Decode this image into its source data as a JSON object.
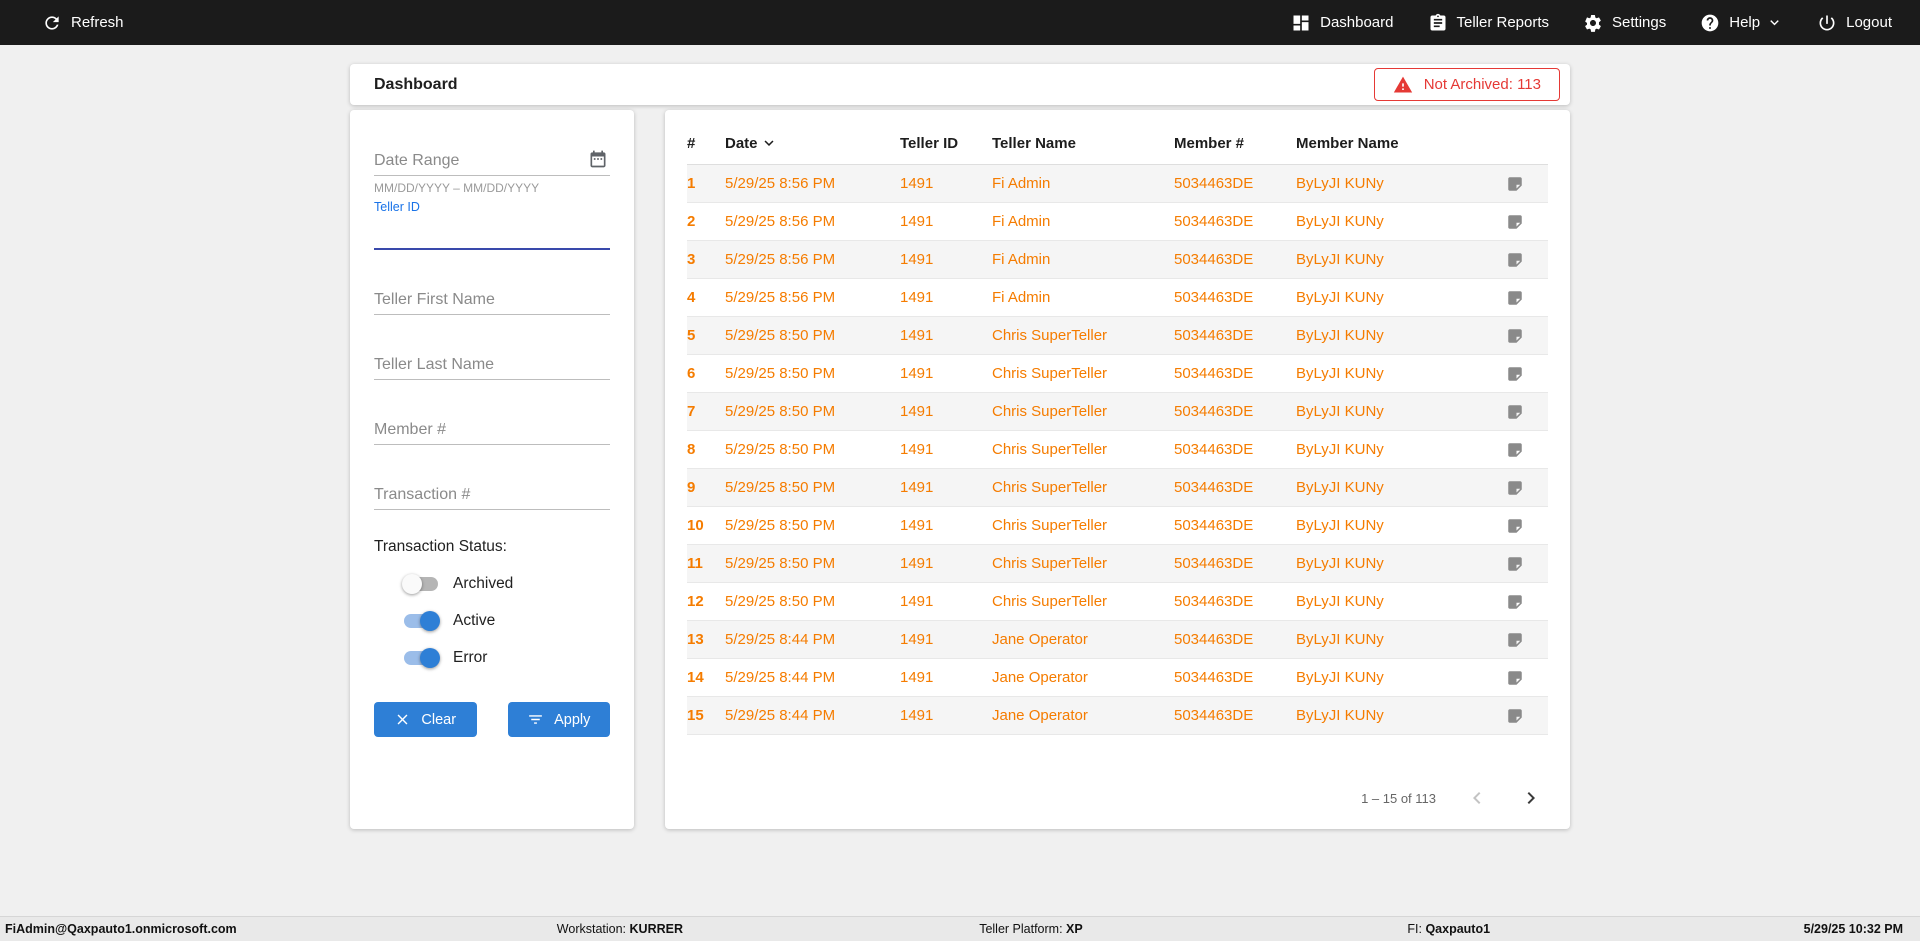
{
  "topbar": {
    "refresh": {
      "label": "Refresh"
    },
    "nav": [
      {
        "label": "Dashboard"
      },
      {
        "label": "Teller Reports"
      },
      {
        "label": "Settings"
      },
      {
        "label": "Help"
      },
      {
        "label": "Logout"
      }
    ]
  },
  "header": {
    "title": "Dashboard",
    "not_archived_badge": "Not Archived: 113"
  },
  "filters": {
    "date_range": {
      "placeholder": "Date Range",
      "value": "",
      "helper": "MM/DD/YYYY – MM/DD/YYYY"
    },
    "teller_id": {
      "label": "Teller ID",
      "value": ""
    },
    "teller_first_name": {
      "placeholder": "Teller First Name",
      "value": ""
    },
    "teller_last_name": {
      "placeholder": "Teller Last Name",
      "value": ""
    },
    "member_number": {
      "placeholder": "Member #",
      "value": ""
    },
    "transaction_number": {
      "placeholder": "Transaction #",
      "value": ""
    },
    "status_label": "Transaction Status:",
    "toggles": [
      {
        "label": "Archived",
        "on": false
      },
      {
        "label": "Active",
        "on": true
      },
      {
        "label": "Error",
        "on": true
      }
    ],
    "clear_button": "Clear",
    "apply_button": "Apply"
  },
  "table": {
    "columns": [
      "#",
      "Date",
      "Teller ID",
      "Teller Name",
      "Member #",
      "Member Name"
    ],
    "sorted_column": "Date",
    "sort_direction": "desc",
    "rows": [
      {
        "num": "1",
        "date": "5/29/25 8:56 PM",
        "teller_id": "1491",
        "teller_name": "Fi Admin",
        "member_num": "5034463DE",
        "member_name": "ByLyJI KUNy"
      },
      {
        "num": "2",
        "date": "5/29/25 8:56 PM",
        "teller_id": "1491",
        "teller_name": "Fi Admin",
        "member_num": "5034463DE",
        "member_name": "ByLyJI KUNy"
      },
      {
        "num": "3",
        "date": "5/29/25 8:56 PM",
        "teller_id": "1491",
        "teller_name": "Fi Admin",
        "member_num": "5034463DE",
        "member_name": "ByLyJI KUNy"
      },
      {
        "num": "4",
        "date": "5/29/25 8:56 PM",
        "teller_id": "1491",
        "teller_name": "Fi Admin",
        "member_num": "5034463DE",
        "member_name": "ByLyJI KUNy"
      },
      {
        "num": "5",
        "date": "5/29/25 8:50 PM",
        "teller_id": "1491",
        "teller_name": "Chris SuperTeller",
        "member_num": "5034463DE",
        "member_name": "ByLyJI KUNy"
      },
      {
        "num": "6",
        "date": "5/29/25 8:50 PM",
        "teller_id": "1491",
        "teller_name": "Chris SuperTeller",
        "member_num": "5034463DE",
        "member_name": "ByLyJI KUNy"
      },
      {
        "num": "7",
        "date": "5/29/25 8:50 PM",
        "teller_id": "1491",
        "teller_name": "Chris SuperTeller",
        "member_num": "5034463DE",
        "member_name": "ByLyJI KUNy"
      },
      {
        "num": "8",
        "date": "5/29/25 8:50 PM",
        "teller_id": "1491",
        "teller_name": "Chris SuperTeller",
        "member_num": "5034463DE",
        "member_name": "ByLyJI KUNy"
      },
      {
        "num": "9",
        "date": "5/29/25 8:50 PM",
        "teller_id": "1491",
        "teller_name": "Chris SuperTeller",
        "member_num": "5034463DE",
        "member_name": "ByLyJI KUNy"
      },
      {
        "num": "10",
        "date": "5/29/25 8:50 PM",
        "teller_id": "1491",
        "teller_name": "Chris SuperTeller",
        "member_num": "5034463DE",
        "member_name": "ByLyJI KUNy"
      },
      {
        "num": "11",
        "date": "5/29/25 8:50 PM",
        "teller_id": "1491",
        "teller_name": "Chris SuperTeller",
        "member_num": "5034463DE",
        "member_name": "ByLyJI KUNy"
      },
      {
        "num": "12",
        "date": "5/29/25 8:50 PM",
        "teller_id": "1491",
        "teller_name": "Chris SuperTeller",
        "member_num": "5034463DE",
        "member_name": "ByLyJI KUNy"
      },
      {
        "num": "13",
        "date": "5/29/25 8:44 PM",
        "teller_id": "1491",
        "teller_name": "Jane Operator",
        "member_num": "5034463DE",
        "member_name": "ByLyJI KUNy"
      },
      {
        "num": "14",
        "date": "5/29/25 8:44 PM",
        "teller_id": "1491",
        "teller_name": "Jane Operator",
        "member_num": "5034463DE",
        "member_name": "ByLyJI KUNy"
      },
      {
        "num": "15",
        "date": "5/29/25 8:44 PM",
        "teller_id": "1491",
        "teller_name": "Jane Operator",
        "member_num": "5034463DE",
        "member_name": "ByLyJI KUNy"
      }
    ],
    "pagination": {
      "range": "1 – 15 of 113"
    }
  },
  "footer": {
    "user": "FiAdmin@Qaxpauto1.onmicrosoft.com",
    "workstation_label": "Workstation:",
    "workstation_value": "KURRER",
    "platform_label": "Teller Platform:",
    "platform_value": "XP",
    "fi_label": "FI:",
    "fi_value": "Qaxpauto1",
    "datetime": "5/29/25 10:32 PM"
  },
  "colors": {
    "topbar_bg": "#1b1b1b",
    "accent_blue": "#2e7fd6",
    "row_orange": "#f57c00",
    "alert_red": "#e53935"
  }
}
